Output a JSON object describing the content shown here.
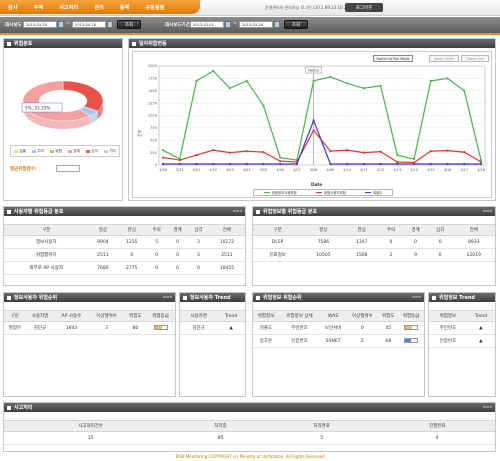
{
  "nav": {
    "items": [
      "감사",
      "추적",
      "사고처리",
      "관리",
      "통계",
      "규정설정"
    ],
    "status_text": "운영관리자 관리자님 로그인 (20.1.69.13 10:22:44)",
    "logout_label": "로그아웃"
  },
  "filter": {
    "label1": "대시보드",
    "start1": "2013-03-30",
    "end1": "2013-04-18",
    "search1": "조회",
    "label2": "대시보드기간",
    "start2": "2013-03-01",
    "end2": "2013-03-26",
    "search2": "조회",
    "tilde": "~"
  },
  "risk_panel": {
    "title": "위험분포",
    "pie_label": "5%, 33.33%",
    "legend": [
      "검출",
      "주의",
      "위험",
      "경계",
      "심각",
      "기타"
    ],
    "legend_colors": [
      "#f6e067",
      "#a9c8f0",
      "#9fd36b",
      "#f0a3a3",
      "#e96b57",
      "#cccccc"
    ],
    "avg_label": "평균위험점수:",
    "avg_value": "",
    "slices": [
      {
        "name": "위험",
        "value": 33.33,
        "color": "#e8524a"
      },
      {
        "name": "주의",
        "value": 5,
        "color": "#a9c8f0"
      },
      {
        "name": "기타",
        "value": 61.67,
        "color": "#f2a0a0"
      }
    ]
  },
  "trend_panel": {
    "title": "일자위험변동",
    "btn_switch": "Switch to Pan Mode",
    "btn_reset": "Reset Chart",
    "btn_zoom": "Zoom Out",
    "tooltip": "Notice",
    "legend": [
      "위험정보사용위험",
      "위험사용자위험",
      "위험도"
    ]
  },
  "chart_data": {
    "type": "line",
    "xlabel": "Date",
    "ylabel": "건수",
    "ylim": [
      0,
      2000
    ],
    "y_ticks": [
      "0",
      "250",
      "500",
      "750",
      "1000",
      "1250",
      "1500",
      "1750",
      "2000"
    ],
    "categories": [
      "3/30",
      "3/31",
      "4/01",
      "4/02",
      "4/03",
      "4/04",
      "4/05",
      "4/06",
      "4/07",
      "4/08",
      "4/09",
      "4/10",
      "4/11",
      "4/12",
      "4/13",
      "4/14",
      "4/15",
      "4/16",
      "4/17",
      "4/18"
    ],
    "x_tick_labels": [
      "3/30",
      "3/31",
      "4/01",
      "4/02",
      "4/03",
      "4/04",
      "4/05",
      "4/06",
      "4/07",
      "4/08",
      "4/09",
      "4/10",
      "4/11",
      "4/12",
      "4/13",
      "4/14",
      "4/15",
      "4/16",
      "4/17",
      "4/18"
    ],
    "series": [
      {
        "name": "위험정보사용위험",
        "color": "#4ab34a",
        "values": [
          300,
          120,
          1700,
          1900,
          1550,
          1700,
          1200,
          150,
          100,
          1700,
          1780,
          1650,
          1550,
          1600,
          200,
          120,
          1700,
          1750,
          1500,
          100
        ]
      },
      {
        "name": "위험사용자위험",
        "color": "#e03a2a",
        "values": [
          150,
          100,
          200,
          300,
          250,
          280,
          260,
          80,
          60,
          700,
          280,
          300,
          250,
          270,
          60,
          50,
          280,
          290,
          260,
          60
        ]
      },
      {
        "name": "위험도",
        "color": "#3a3ad6",
        "values": [
          20,
          20,
          20,
          20,
          20,
          20,
          20,
          20,
          20,
          900,
          20,
          20,
          20,
          20,
          20,
          20,
          20,
          20,
          20,
          20
        ]
      }
    ]
  },
  "user_risk": {
    "title": "사용자별 위험등급 분포",
    "more": "more",
    "headers": [
      "구분",
      "정상",
      "관심",
      "주의",
      "경계",
      "심각",
      "전체"
    ],
    "rows": [
      [
        "정보사용자",
        "8904",
        "1235",
        "5",
        "0",
        "3",
        "10172"
      ],
      [
        "위험행위자",
        "2511",
        "0",
        "0",
        "0",
        "3",
        "2511"
      ],
      [
        "외부로 AP 사용자",
        "7680",
        "2775",
        "0",
        "0",
        "0",
        "10455"
      ]
    ]
  },
  "info_risk": {
    "title": "위험정보별 위험등급 분포",
    "more": "more",
    "headers": [
      "구분",
      "정상",
      "관심",
      "주의",
      "경계",
      "심각",
      "전체"
    ],
    "rows": [
      [
        "DLSP",
        "7596",
        "1347",
        "0",
        "0",
        "0",
        "8933"
      ],
      [
        "유료정보",
        "10505",
        "1508",
        "2",
        "9",
        "0",
        "12019"
      ]
    ]
  },
  "info_user_rank": {
    "title": "정보사용자 위험순위",
    "more": "more",
    "headers": [
      "구분",
      "사용자명",
      "AP 사용수",
      "이상행위수",
      "위험도",
      "위험등급"
    ],
    "rows": [
      [
        "영업부",
        "김민규",
        "1843",
        "3",
        "86",
        ""
      ]
    ],
    "risk_level": 0.6
  },
  "info_user_trend": {
    "title": "정보사용자 Trend",
    "headers": [
      "사용자명",
      "Trend"
    ],
    "rows": [
      [
        "김민규",
        "▲"
      ]
    ]
  },
  "info_risk_rank": {
    "title": "위험정보 위험순위",
    "more": "more",
    "headers": [
      "위험정보",
      "위험정보 상세",
      "WAS",
      "이상행위수",
      "위험도",
      "위험등급"
    ],
    "rows": [
      [
        "검출도",
        "주민번호",
        "보안서버",
        "0",
        "45",
        ""
      ],
      [
        "암호문",
        "인증번호",
        "SSNET",
        "2",
        "68",
        ""
      ]
    ],
    "risk_levels": [
      0.55,
      0.5
    ],
    "risk_colors": [
      "#e6c05a",
      "#5a7fe6"
    ]
  },
  "info_risk_trend": {
    "title": "위험정보 Trend",
    "headers": [
      "위험정보",
      "Trend"
    ],
    "rows": [
      [
        "주민번호",
        "▲"
      ],
      [
        "인증번호",
        "▲"
      ]
    ]
  },
  "incident": {
    "title": "사고처리",
    "more": "more",
    "headers": [
      "사고처리건수",
      "처리중",
      "처리완료",
      "진행완료"
    ],
    "values": [
      "15",
      "85",
      "5",
      "4"
    ]
  },
  "footer": "RISK Monitoring    COPYRIGHT (c) Ministry of Unification. All Rights Reserved"
}
